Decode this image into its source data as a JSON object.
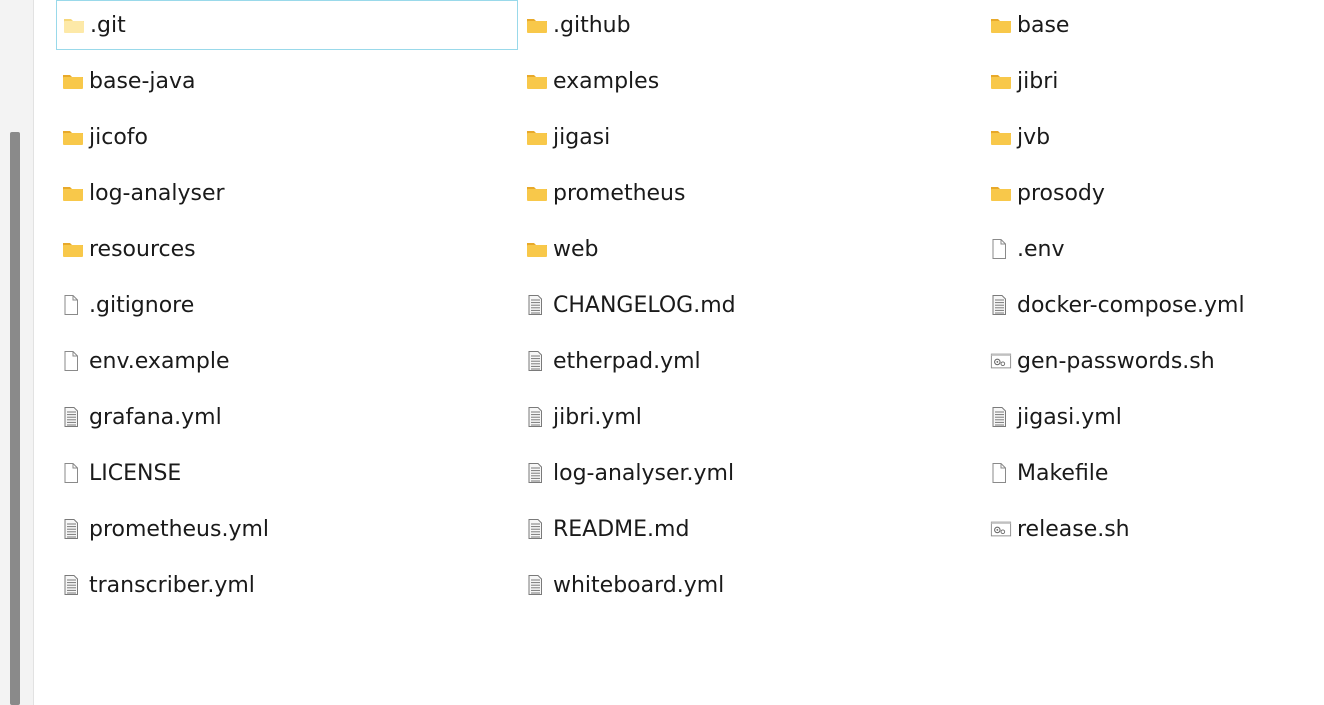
{
  "file_list": {
    "items": [
      {
        "name": ".git",
        "icon": "folder-open-icon",
        "selected": true
      },
      {
        "name": ".github",
        "icon": "folder-icon"
      },
      {
        "name": "base",
        "icon": "folder-icon"
      },
      {
        "name": "base-java",
        "icon": "folder-icon"
      },
      {
        "name": "examples",
        "icon": "folder-icon"
      },
      {
        "name": "jibri",
        "icon": "folder-icon"
      },
      {
        "name": "jicofo",
        "icon": "folder-icon"
      },
      {
        "name": "jigasi",
        "icon": "folder-icon"
      },
      {
        "name": "jvb",
        "icon": "folder-icon"
      },
      {
        "name": "log-analyser",
        "icon": "folder-icon"
      },
      {
        "name": "prometheus",
        "icon": "folder-icon"
      },
      {
        "name": "prosody",
        "icon": "folder-icon"
      },
      {
        "name": "resources",
        "icon": "folder-icon"
      },
      {
        "name": "web",
        "icon": "folder-icon"
      },
      {
        "name": ".env",
        "icon": "blank-file-icon"
      },
      {
        "name": ".gitignore",
        "icon": "blank-file-icon"
      },
      {
        "name": "CHANGELOG.md",
        "icon": "text-file-icon"
      },
      {
        "name": "docker-compose.yml",
        "icon": "text-file-icon"
      },
      {
        "name": "env.example",
        "icon": "blank-file-icon"
      },
      {
        "name": "etherpad.yml",
        "icon": "text-file-icon"
      },
      {
        "name": "gen-passwords.sh",
        "icon": "script-file-icon"
      },
      {
        "name": "grafana.yml",
        "icon": "text-file-icon"
      },
      {
        "name": "jibri.yml",
        "icon": "text-file-icon"
      },
      {
        "name": "jigasi.yml",
        "icon": "text-file-icon"
      },
      {
        "name": "LICENSE",
        "icon": "blank-file-icon"
      },
      {
        "name": "log-analyser.yml",
        "icon": "text-file-icon"
      },
      {
        "name": "Makefile",
        "icon": "blank-file-icon"
      },
      {
        "name": "prometheus.yml",
        "icon": "text-file-icon"
      },
      {
        "name": "README.md",
        "icon": "text-file-icon"
      },
      {
        "name": "release.sh",
        "icon": "script-file-icon"
      },
      {
        "name": "transcriber.yml",
        "icon": "text-file-icon"
      },
      {
        "name": "whiteboard.yml",
        "icon": "text-file-icon"
      }
    ]
  },
  "colors": {
    "folder": "#f8c84a",
    "folder_dark": "#e8a92a",
    "selection_border": "#99d9ea",
    "scrollbar": "#8a8a8a"
  }
}
